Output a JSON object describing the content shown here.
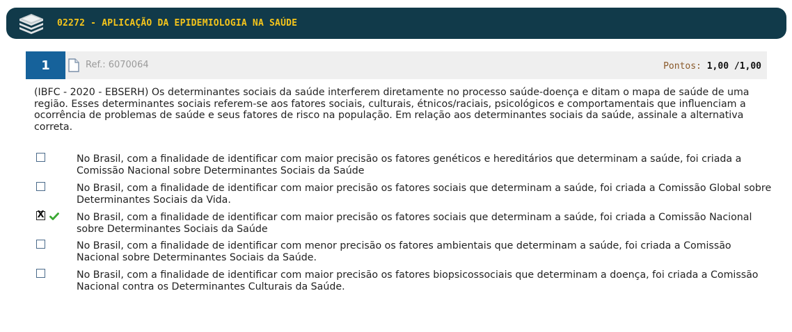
{
  "header": {
    "title": "02272 - APLICAÇÃO DA EPIDEMIOLOGIA NA SAÚDE"
  },
  "question": {
    "number": "1",
    "ref": "Ref.: 6070064",
    "points_label": "Pontos:",
    "points_value": "1,00",
    "points_separator": "/",
    "points_total": "1,00",
    "text": "(IBFC - 2020 - EBSERH) Os determinantes sociais da saúde interferem diretamente no processo saúde-doença e ditam o mapa de saúde de uma região. Esses determinantes sociais referem-se aos fatores sociais, culturais, étnicos/raciais, psicológicos e comportamentais que influenciam a ocorrência de problemas de saúde e seus fatores de risco na população. Em relação aos determinantes sociais da saúde, assinale a alternativa correta."
  },
  "options": [
    {
      "text": "No Brasil, com a finalidade de identificar com maior precisão os fatores genéticos e hereditários que determinam a saúde, foi criada a Comissão Nacional sobre Determinantes Sociais da Saúde",
      "checked": false
    },
    {
      "text": "No Brasil, com a finalidade de identificar com maior precisão os fatores sociais que determinam a saúde, foi criada a Comissão Global sobre Determinantes Sociais da Vida.",
      "checked": false
    },
    {
      "text": "No Brasil, com a finalidade de identificar com maior precisão os fatores sociais que determinam a saúde, foi criada a Comissão Nacional sobre Determinantes Sociais da Saúde",
      "checked": true,
      "checkmark": "X",
      "correct_icon": "green-check-icon"
    },
    {
      "text": "No Brasil, com a finalidade de identificar com menor precisão os fatores ambientais que determinam a saúde, foi criada a Comissão Nacional sobre Determinantes Sociais da Saúde.",
      "checked": false
    },
    {
      "text": "No Brasil, com a finalidade de identificar com maior precisão os fatores biopsicossociais que determinam a doença, foi criada a Comissão Nacional contra os Determinantes Culturais da Saúde.",
      "checked": false
    }
  ],
  "colors": {
    "header_bg": "#113a4a",
    "header_text": "#f5c51b",
    "number_bg": "#16629b",
    "correct": "#3aa832"
  }
}
